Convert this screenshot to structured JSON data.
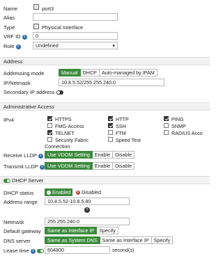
{
  "interface": {
    "name_label": "Name",
    "name_value": "port3",
    "alias_label": "Alias",
    "alias_value": "",
    "type_label": "Type",
    "type_value": "Physical Interface",
    "vrf_label": "VRF ID",
    "vrf_value": "0",
    "role_label": "Role",
    "role_value": "Undefined"
  },
  "address": {
    "section_title": "Address",
    "mode_label": "Addressing mode",
    "modes": [
      "Manual",
      "DHCP",
      "Auto-managed by IPAM"
    ],
    "ip_label": "IP/Netmask",
    "ip_value": "10.8.5.52/255.255.240.0",
    "secondary_label": "Secondary IP address"
  },
  "admin": {
    "section_title": "Administrative Access",
    "ipv4_label": "IPv4",
    "options": [
      {
        "label": "HTTPS",
        "checked": true
      },
      {
        "label": "HTTP",
        "checked": true
      },
      {
        "label": "PING",
        "checked": true
      },
      {
        "label": "FMG-Access",
        "checked": false
      },
      {
        "label": "SSH",
        "checked": true
      },
      {
        "label": "SNMP",
        "checked": false
      },
      {
        "label": "TELNET",
        "checked": true
      },
      {
        "label": "FTM",
        "checked": false
      },
      {
        "label": "RADIUS Acco",
        "checked": false
      },
      {
        "label": "Security Fabric",
        "checked": false
      },
      {
        "label": "Connection",
        "checked": false
      },
      {
        "label": "Speed Test",
        "checked": false
      }
    ],
    "receive_lldp_label": "Receive LLDP",
    "transmit_lldp_label": "Transmit LLDP",
    "lldp_options": [
      "Use VDOM Setting",
      "Enable",
      "Disable"
    ]
  },
  "dhcp": {
    "section_title": "DHCP Server",
    "status_label": "DHCP status",
    "enabled_label": "Enabled",
    "disabled_label": "Disabled",
    "range_label": "Address range",
    "range_value": "10.8.5.52-10.8.5.80",
    "netmask_label": "Netmask",
    "netmask_value": "255.255.240.0",
    "gateway_label": "Default gateway",
    "gateway_options": [
      "Same as Interface IP",
      "Specify"
    ],
    "dns_label": "DNS server",
    "dns_options": [
      "Same as System DNS",
      "Same as Interface IP",
      "Specify"
    ],
    "lease_label": "Lease time",
    "lease_value": "604800",
    "lease_unit": "second(s)"
  },
  "colors": {
    "accent_green": "#3c8a3c",
    "info_blue": "#2e6da4"
  }
}
